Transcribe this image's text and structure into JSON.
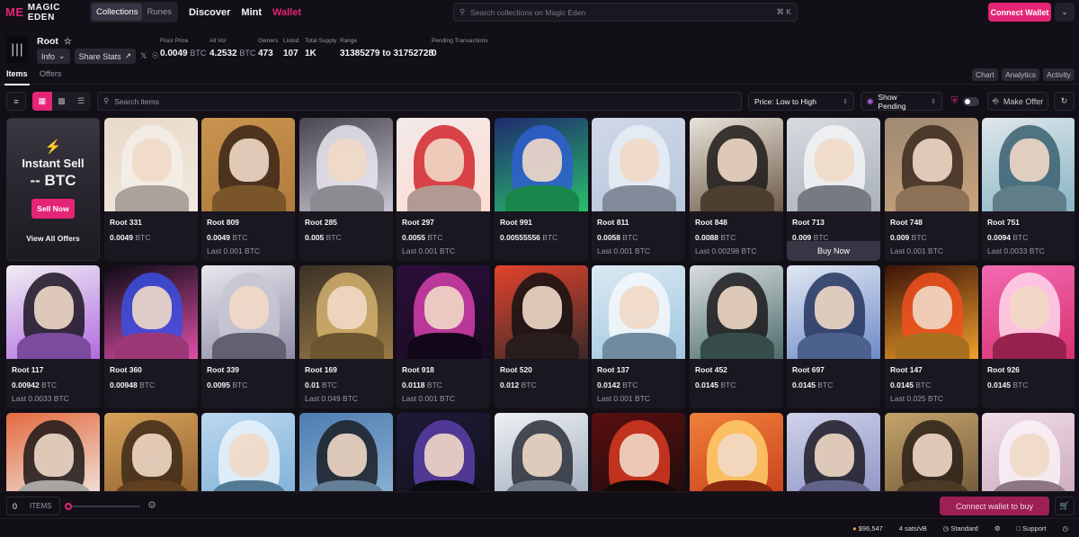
{
  "nav": {
    "brand": "MAGIC EDEN",
    "segments": [
      "Collections",
      "Runes"
    ],
    "links": [
      "Discover",
      "Mint",
      "Wallet"
    ],
    "search_placeholder": "Search collections on Magic Eden",
    "shortcut": "⌘ K",
    "connect_label": "Connect Wallet"
  },
  "collection": {
    "name": "Root",
    "info_label": "Info",
    "share_label": "Share Stats",
    "stats": [
      {
        "label": "Floor Price",
        "value": "0.0049",
        "unit": "BTC"
      },
      {
        "label": "All Vol",
        "value": "4.2532",
        "unit": "BTC"
      },
      {
        "label": "Owners",
        "value": "473",
        "unit": ""
      },
      {
        "label": "Listed",
        "value": "107",
        "unit": ""
      },
      {
        "label": "Total Supply",
        "value": "1K",
        "unit": ""
      },
      {
        "label": "Range",
        "value": "31385279 to 31752728",
        "unit": ""
      },
      {
        "label": "Pending Transactions",
        "value": "0",
        "unit": ""
      }
    ]
  },
  "tabs": {
    "items": "Items",
    "offers": "Offers",
    "right": [
      "Chart",
      "Analytics",
      "Activity"
    ]
  },
  "toolbar": {
    "search_placeholder": "Search items",
    "sort": "Price: Low to High",
    "pending": "Show Pending",
    "make_offer": "Make Offer"
  },
  "instant": {
    "title": "Instant Sell",
    "price": "-- BTC",
    "sell": "Sell Now",
    "all_offers": "View All Offers"
  },
  "cards": [
    {
      "name": "Root 331",
      "price": "0.0049",
      "unit": "BTC",
      "last": "",
      "colors": [
        "#e8d9c9",
        "#f4efe9",
        "#f3e9df"
      ]
    },
    {
      "name": "Root 809",
      "price": "0.0049",
      "unit": "BTC",
      "last": "Last 0.001 BTC",
      "colors": [
        "#c9944f",
        "#3a2417",
        "#b07a3c"
      ]
    },
    {
      "name": "Root 285",
      "price": "0.005",
      "unit": "BTC",
      "last": "",
      "colors": [
        "#4a4650",
        "#e9e6ef",
        "#c9c6d1"
      ]
    },
    {
      "name": "Root 297",
      "price": "0.0055",
      "unit": "BTC",
      "last": "Last 0.001 BTC",
      "colors": [
        "#f2eaea",
        "#d2262c",
        "#ffdcd0"
      ]
    },
    {
      "name": "Root 991",
      "price": "0.00555556",
      "unit": "BTC",
      "last": "",
      "colors": [
        "#1f2a6e",
        "#2f5fd0",
        "#27c06b"
      ]
    },
    {
      "name": "Root 811",
      "price": "0.0058",
      "unit": "BTC",
      "last": "Last 0.001 BTC",
      "colors": [
        "#cfd8e8",
        "#e9eef6",
        "#b8c6dc"
      ]
    },
    {
      "name": "Root 848",
      "price": "0.0088",
      "unit": "BTC",
      "last": "Last 0.00298 BTC",
      "colors": [
        "#e8e3da",
        "#1f1b1a",
        "#6d5a48"
      ]
    },
    {
      "name": "Root 713",
      "price": "0.009",
      "unit": "BTC",
      "last": "",
      "buy": "Buy Now",
      "colors": [
        "#d8dbe0",
        "#f3f4f6",
        "#a9b0bb"
      ]
    },
    {
      "name": "Root 748",
      "price": "0.009",
      "unit": "BTC",
      "last": "Last 0.001 BTC",
      "colors": [
        "#9e8a74",
        "#3b2a20",
        "#c9a27b"
      ]
    },
    {
      "name": "Root 751",
      "price": "0.0094",
      "unit": "BTC",
      "last": "Last 0.0033 BTC",
      "colors": [
        "#dfe7ec",
        "#3a6070",
        "#88b4c2"
      ]
    },
    {
      "name": "Root 117",
      "price": "0.00942",
      "unit": "BTC",
      "last": "Last 0.0033 BTC",
      "colors": [
        "#f0eef3",
        "#1a1420",
        "#b06be0"
      ]
    },
    {
      "name": "Root 360",
      "price": "0.00948",
      "unit": "BTC",
      "last": "",
      "colors": [
        "#0b0a14",
        "#3b4fe0",
        "#e04fa9"
      ]
    },
    {
      "name": "Root 339",
      "price": "0.0095",
      "unit": "BTC",
      "last": "",
      "colors": [
        "#e9e7ee",
        "#c7c5d2",
        "#8c8aa3"
      ]
    },
    {
      "name": "Root 169",
      "price": "0.01",
      "unit": "BTC",
      "last": "Last 0.049 BTC",
      "colors": [
        "#3b3127",
        "#d4b16f",
        "#9b7b45"
      ]
    },
    {
      "name": "Root 918",
      "price": "0.0118",
      "unit": "BTC",
      "last": "Last 0.001 BTC",
      "colors": [
        "#2c0f3a",
        "#d63fae",
        "#1a0a22"
      ]
    },
    {
      "name": "Root 520",
      "price": "0.012",
      "unit": "BTC",
      "last": "",
      "colors": [
        "#e2432b",
        "#151214",
        "#3a2a2a"
      ]
    },
    {
      "name": "Root 137",
      "price": "0.0142",
      "unit": "BTC",
      "last": "Last 0.001 BTC",
      "colors": [
        "#dce9f2",
        "#f5f8fb",
        "#9fc7e0"
      ]
    },
    {
      "name": "Root 452",
      "price": "0.0145",
      "unit": "BTC",
      "last": "",
      "colors": [
        "#d9dde0",
        "#1c1a1c",
        "#4c6c6a"
      ]
    },
    {
      "name": "Root 697",
      "price": "0.0145",
      "unit": "BTC",
      "last": "",
      "colors": [
        "#e2e8f3",
        "#24345e",
        "#6d8ac7"
      ]
    },
    {
      "name": "Root 147",
      "price": "0.0145",
      "unit": "BTC",
      "last": "Last 0.025 BTC",
      "colors": [
        "#3a1208",
        "#f0501e",
        "#f0a02b"
      ]
    },
    {
      "name": "Root 926",
      "price": "0.0145",
      "unit": "BTC",
      "last": "",
      "colors": [
        "#f26bb2",
        "#ffd7ec",
        "#d8306f"
      ]
    },
    {
      "name": "",
      "price": "",
      "unit": "",
      "last": "",
      "colors": [
        "#e36a3f",
        "#1b1718",
        "#f2ede8"
      ]
    },
    {
      "name": "",
      "price": "",
      "unit": "",
      "last": "",
      "colors": [
        "#d7a35a",
        "#3d2a18",
        "#8b5b2c"
      ]
    },
    {
      "name": "",
      "price": "",
      "unit": "",
      "last": "",
      "colors": [
        "#bcd8ef",
        "#e9f3fb",
        "#7aaed6"
      ]
    },
    {
      "name": "",
      "price": "",
      "unit": "",
      "last": "",
      "colors": [
        "#4e7db0",
        "#1b1e24",
        "#8fb6d9"
      ]
    },
    {
      "name": "",
      "price": "",
      "unit": "",
      "last": "",
      "colors": [
        "#1e1a38",
        "#5b3ea8",
        "#111018"
      ]
    },
    {
      "name": "",
      "price": "",
      "unit": "",
      "last": "",
      "colors": [
        "#eef1f4",
        "#2a2f3a",
        "#9aa7b8"
      ]
    },
    {
      "name": "",
      "price": "",
      "unit": "",
      "last": "",
      "colors": [
        "#5a0f10",
        "#d83a22",
        "#1a0c0c"
      ]
    },
    {
      "name": "",
      "price": "",
      "unit": "",
      "last": "",
      "colors": [
        "#f0803a",
        "#ffcf6a",
        "#c53b1a"
      ]
    },
    {
      "name": "",
      "price": "",
      "unit": "",
      "last": "",
      "colors": [
        "#cfd3ea",
        "#1c1a24",
        "#8a8fc2"
      ]
    },
    {
      "name": "",
      "price": "",
      "unit": "",
      "last": "",
      "colors": [
        "#c3a46c",
        "#2a2018",
        "#6e5335"
      ]
    },
    {
      "name": "",
      "price": "",
      "unit": "",
      "last": "",
      "colors": [
        "#f1dce8",
        "#f9f2f6",
        "#c9a7ba"
      ]
    }
  ],
  "bottom": {
    "qty": "0",
    "items_label": "ITEMS",
    "connect_buy": "Connect wallet to buy"
  },
  "status": {
    "btc_price": "$96,547",
    "fee": "4 sats/vB",
    "mode": "Standard",
    "support": "Support"
  },
  "colors": {
    "accent": "#e42575",
    "background": "#120f17"
  }
}
